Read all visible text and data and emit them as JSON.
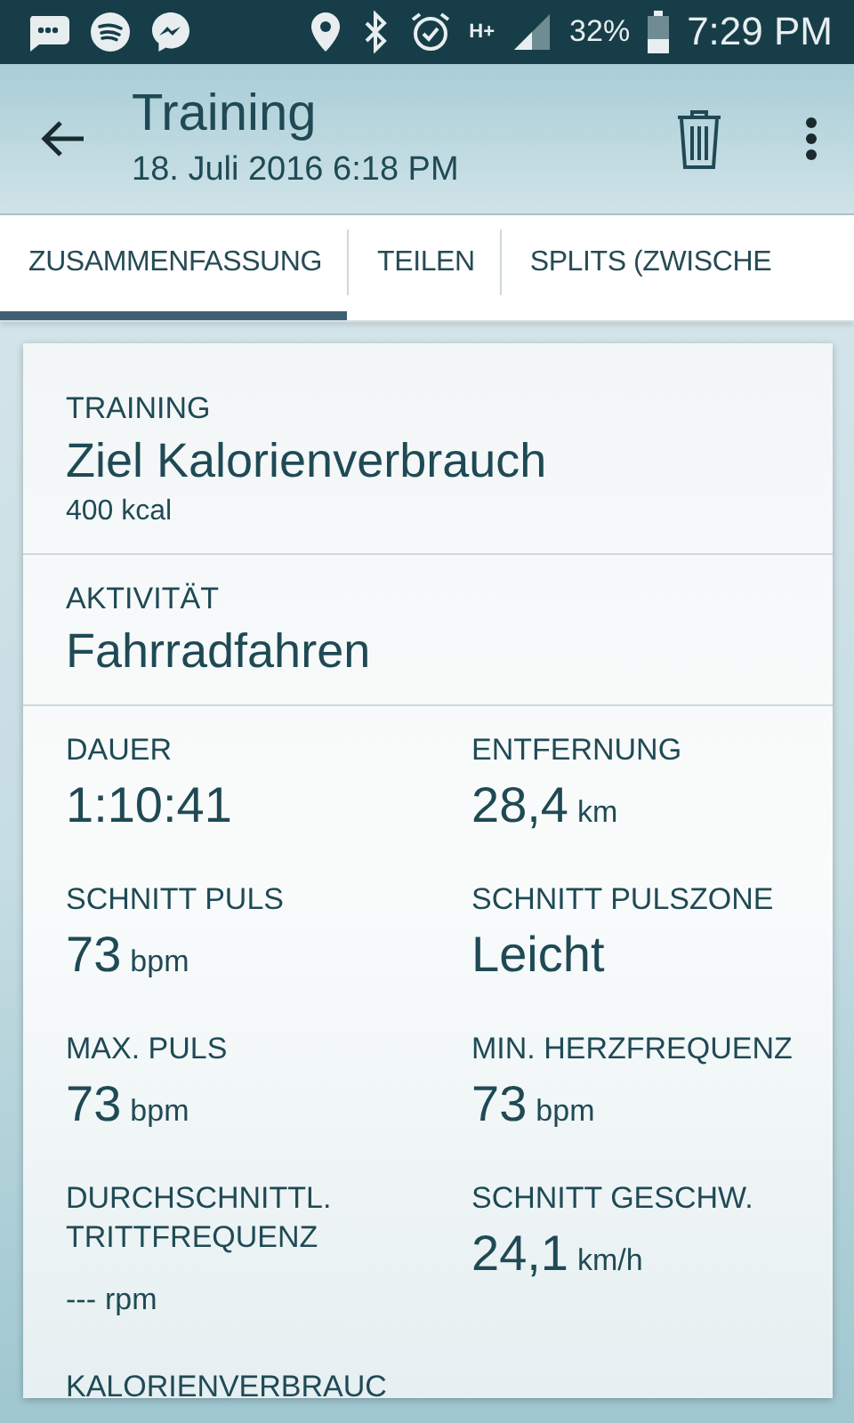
{
  "status_bar": {
    "battery": "32%",
    "time": "7:29 PM",
    "network": "H+"
  },
  "app_bar": {
    "title": "Training",
    "subtitle": "18. Juli 2016 6:18 PM"
  },
  "tabs": [
    {
      "label": "ZUSAMMENFASSUNG",
      "selected": true
    },
    {
      "label": "TEILEN",
      "selected": false
    },
    {
      "label": "SPLITS (ZWISCHE",
      "selected": false
    }
  ],
  "sections": [
    {
      "label": "TRAINING",
      "value": "Ziel Kalorienverbrauch",
      "detail": "400 kcal"
    },
    {
      "label": "AKTIVITÄT",
      "value": "Fahrradfahren"
    }
  ],
  "metrics": [
    {
      "label": "DAUER",
      "value": "1:10:41"
    },
    {
      "label": "ENTFERNUNG",
      "value": "28,4",
      "unit": "km"
    },
    {
      "label": "SCHNITT PULS",
      "value": "73",
      "unit": "bpm"
    },
    {
      "label": "SCHNITT PULSZONE",
      "value": "Leicht"
    },
    {
      "label": "MAX. PULS",
      "value": "73",
      "unit": "bpm"
    },
    {
      "label": "MIN. HERZFREQUENZ",
      "value": "73",
      "unit": "bpm"
    },
    {
      "label": "DURCHSCHNITTL. TRITTFREQUENZ",
      "value": "---",
      "unit": "rpm",
      "small": true
    },
    {
      "label": "SCHNITT GESCHW.",
      "value": "24,1",
      "unit": "km/h"
    },
    {
      "label": "KALORIENVERBRAUC"
    }
  ]
}
